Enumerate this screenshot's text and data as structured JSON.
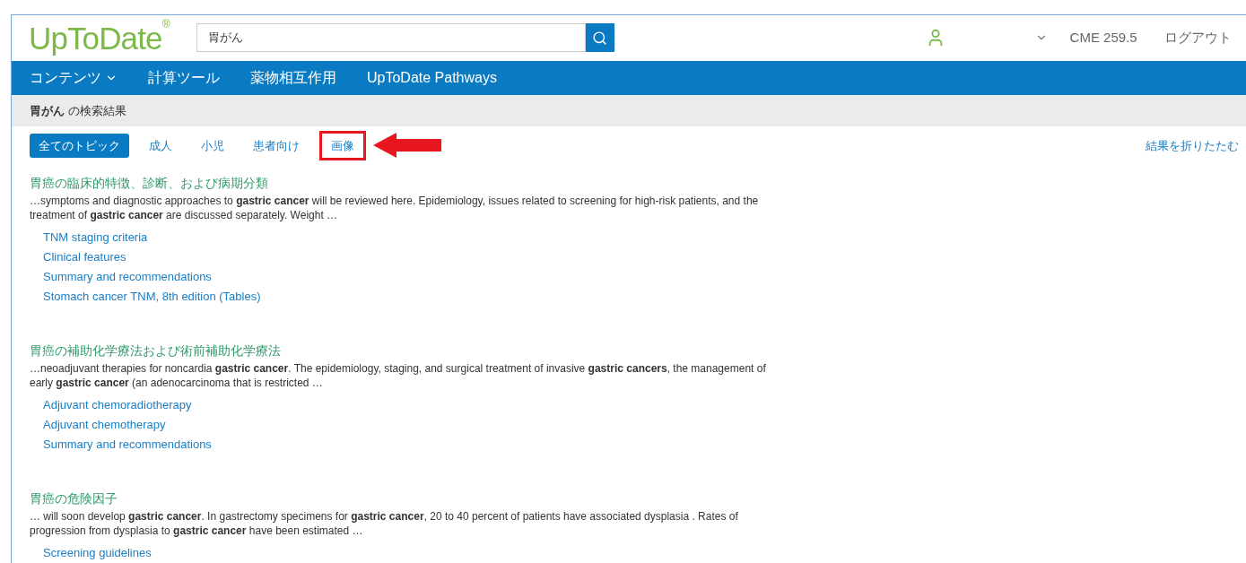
{
  "header": {
    "logo": "UpToDate",
    "logo_mark": "®",
    "search": {
      "value": "胃がん"
    },
    "cme": "CME 259.5",
    "logout": "ログアウト"
  },
  "nav": [
    "コンテンツ",
    "計算ツール",
    "薬物相互作用",
    "UpToDate Pathways"
  ],
  "results_heading": "**胃がん** の検索結果",
  "filters": [
    {
      "label": "全てのトピック",
      "selected": true,
      "highlighted": false
    },
    {
      "label": "成人",
      "selected": false,
      "highlighted": false
    },
    {
      "label": "小児",
      "selected": false,
      "highlighted": false
    },
    {
      "label": "患者向け",
      "selected": false,
      "highlighted": false
    },
    {
      "label": "画像",
      "selected": false,
      "highlighted": true
    }
  ],
  "collapse_link": "結果を折りたたむ",
  "results": [
    {
      "title": "胃癌の臨床的特徴、診断、および病期分類",
      "snippet": "…symptoms and diagnostic approaches to **gastric cancer** will be reviewed here. Epidemiology, issues related to screening for high-risk patients, and the treatment of **gastric cancer** are discussed separately. Weight …",
      "links": [
        "TNM staging criteria",
        "Clinical features",
        "Summary and recommendations",
        "Stomach cancer TNM, 8th edition (Tables)"
      ]
    },
    {
      "title": "胃癌の補助化学療法および術前補助化学療法",
      "snippet": "…neoadjuvant therapies for noncardia **gastric cancer**. The epidemiology, staging, and surgical treatment of invasive **gastric cancers**, the management of early **gastric cancer** (an adenocarcinoma that is restricted …",
      "links": [
        "Adjuvant chemoradiotherapy",
        "Adjuvant chemotherapy",
        "Summary and recommendations"
      ]
    },
    {
      "title": "胃癌の危険因子",
      "snippet": "… will soon develop **gastric cancer**. In gastrectomy specimens for **gastric cancer**, 20 to 40 percent of patients have associated dysplasia . Rates of progression from dysplasia to **gastric cancer** have been estimated …",
      "links": [
        "Screening guidelines"
      ]
    }
  ]
}
